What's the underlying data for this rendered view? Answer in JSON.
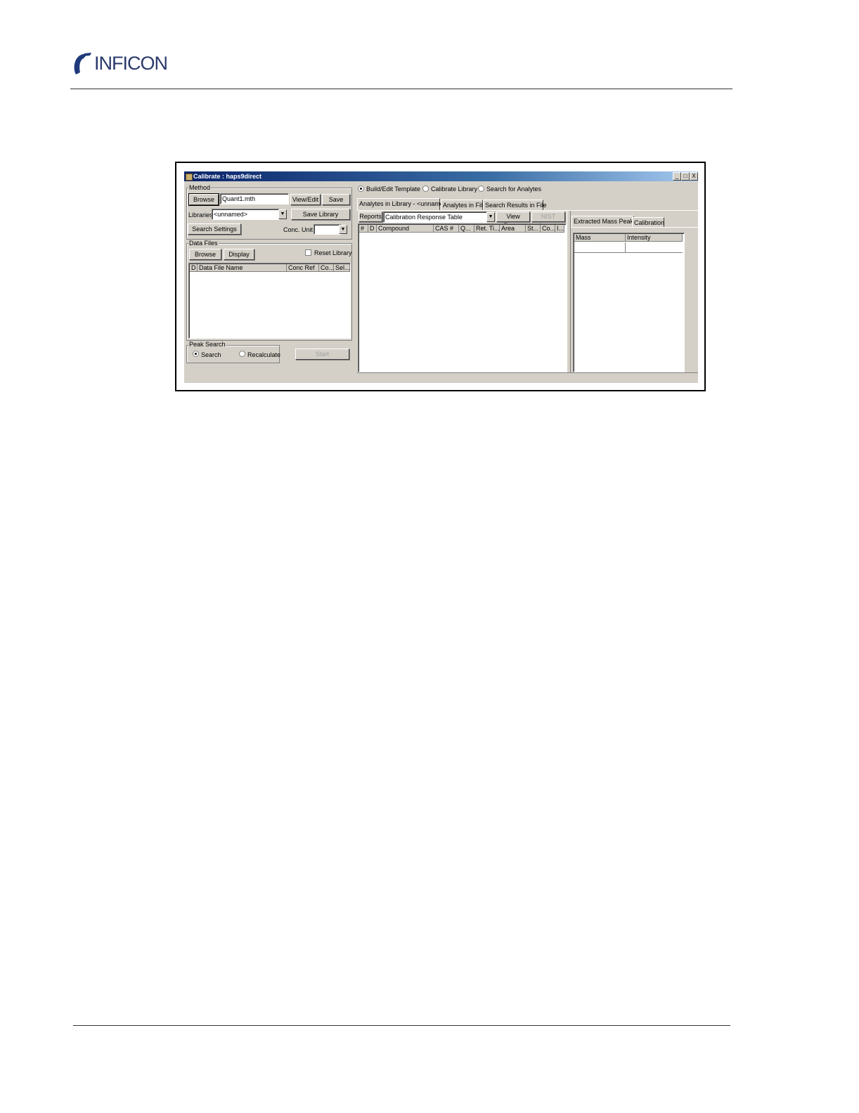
{
  "brand": {
    "name": "INFICON"
  },
  "window": {
    "title": "Calibrate : haps9direct",
    "controls": {
      "minimize": "_",
      "maximize": "□",
      "close": "X"
    }
  },
  "method": {
    "group_label": "Method",
    "browse": "Browse",
    "file_value": "Quant1.mth",
    "view_edit": "View/Edit",
    "save": "Save",
    "libraries_label": "Libraries",
    "libraries_value": "<unnamed>",
    "save_library": "Save Library",
    "search_settings": "Search Settings",
    "conc_unit_label": "Conc. Unit",
    "conc_unit_value": ""
  },
  "data_files": {
    "group_label": "Data Files",
    "browse": "Browse",
    "display": "Display",
    "reset_library": "Reset Library",
    "reset_library_checked": false,
    "columns": [
      "D",
      "Data File Name",
      "Conc Ref",
      "Co...",
      "Sel..."
    ]
  },
  "peak_search": {
    "group_label": "Peak Search",
    "search": "Search",
    "recalculate": "Recalculate",
    "selected": "Search",
    "start": "Start"
  },
  "mode": {
    "options": [
      "Build/Edit Template",
      "Calibrate Library",
      "Search for Analytes"
    ],
    "selected": "Build/Edit Template"
  },
  "main_tabs": [
    "Analytes in Library - <unnamed>",
    "Analytes in File",
    "Search Results in File"
  ],
  "reports": {
    "button": "Reports",
    "selected": "Calibration Response Table",
    "view_report": "View Report",
    "nist_search": "NIST Search"
  },
  "analyte_columns": [
    "#",
    "D",
    "Compound",
    "CAS #",
    "Q...",
    "Ret. Ti...",
    "Area",
    "St...",
    "Co...",
    "I..."
  ],
  "right_tabs": [
    "Extracted Mass Peaks",
    "Calibration"
  ],
  "mass_columns": [
    "Mass",
    "Intensity"
  ]
}
